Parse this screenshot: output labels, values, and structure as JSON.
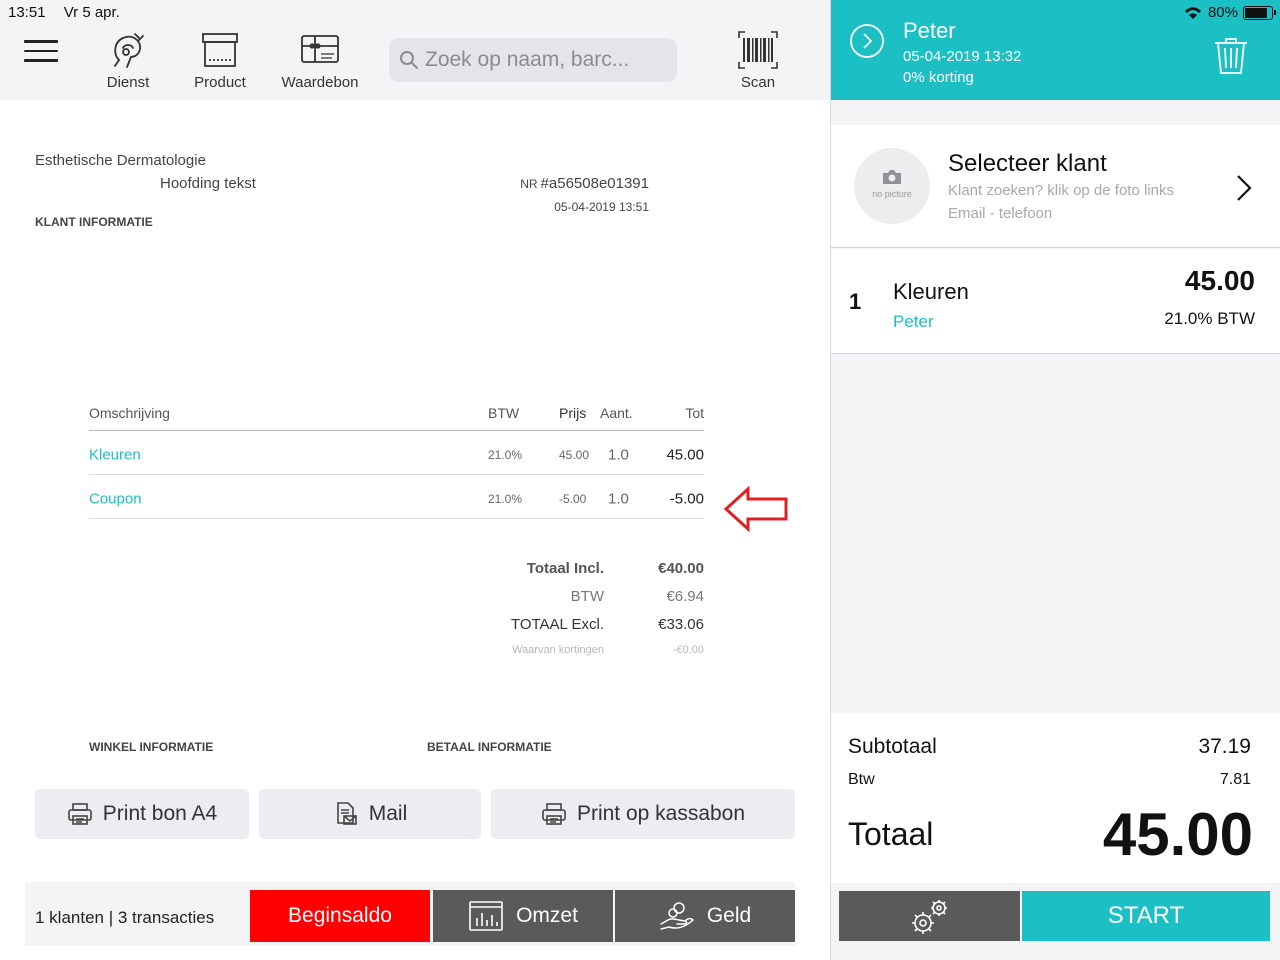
{
  "status_bar": {
    "time": "13:51",
    "date": "Vr 5 apr.",
    "battery": "80%"
  },
  "toolbar": {
    "items": [
      {
        "label": "Dienst",
        "icon": "service-icon"
      },
      {
        "label": "Product",
        "icon": "product-box-icon"
      },
      {
        "label": "Waardebon",
        "icon": "voucher-icon"
      }
    ],
    "search_placeholder": "Zoek op naam, barc...",
    "scan_label": "Scan"
  },
  "receipt": {
    "company": "Esthetische Dermatologie",
    "header_text": "Hoofding tekst",
    "nr_label": "NR",
    "nr_value": "#a56508e01391",
    "date": "05-04-2019 13:51",
    "customer_info_label": "KLANT INFORMATIE",
    "columns": {
      "description": "Omschrijving",
      "vat": "BTW",
      "price": "Prijs",
      "qty": "Aant.",
      "total": "Tot"
    },
    "rows": [
      {
        "description": "Kleuren",
        "vat": "21.0%",
        "price": "45.00",
        "qty": "1.0",
        "total": "45.00"
      },
      {
        "description": "Coupon",
        "vat": "21.0%",
        "price": "-5.00",
        "qty": "1.0",
        "total": "-5.00"
      }
    ],
    "totals": [
      {
        "label": "Totaal Incl.",
        "value": "€40.00",
        "style": "bold"
      },
      {
        "label": "BTW",
        "value": "€6.94",
        "style": "light"
      },
      {
        "label": "TOTAAL Excl.",
        "value": "€33.06",
        "style": "normal"
      },
      {
        "label": "Waarvan kortingen",
        "value": "-€0.00",
        "style": "muted"
      }
    ],
    "shop_info_label": "WINKEL INFORMATIE",
    "payment_info_label": "BETAAL INFORMATIE"
  },
  "actions": {
    "print_a4": "Print bon A4",
    "mail": "Mail",
    "print_register": "Print op kassabon"
  },
  "bottom_bar": {
    "summary": "1 klanten | 3 transacties",
    "beginsaldo": "Beginsaldo",
    "omzet": "Omzet",
    "geld": "Geld"
  },
  "ticket": {
    "customer_name": "Peter",
    "datetime": "05-04-2019 13:32",
    "discount": "0% korting",
    "select_customer": {
      "title": "Selecteer klant",
      "hint": "Klant zoeken? klik op de foto links",
      "contact": "Email - telefoon",
      "avatar_text": "no picture"
    },
    "lines": [
      {
        "qty": "1",
        "name": "Kleuren",
        "staff": "Peter",
        "price": "45.00",
        "vat": "21.0% BTW"
      }
    ],
    "subtotal_label": "Subtotaal",
    "subtotal_value": "37.19",
    "vat_label": "Btw",
    "vat_value": "7.81",
    "total_label": "Totaal",
    "total_value": "45.00",
    "start_label": "START"
  },
  "colors": {
    "accent": "#1bbfc4",
    "danger": "#ff0000",
    "dark_button": "#5a5a5d",
    "arrow": "#e02020"
  }
}
